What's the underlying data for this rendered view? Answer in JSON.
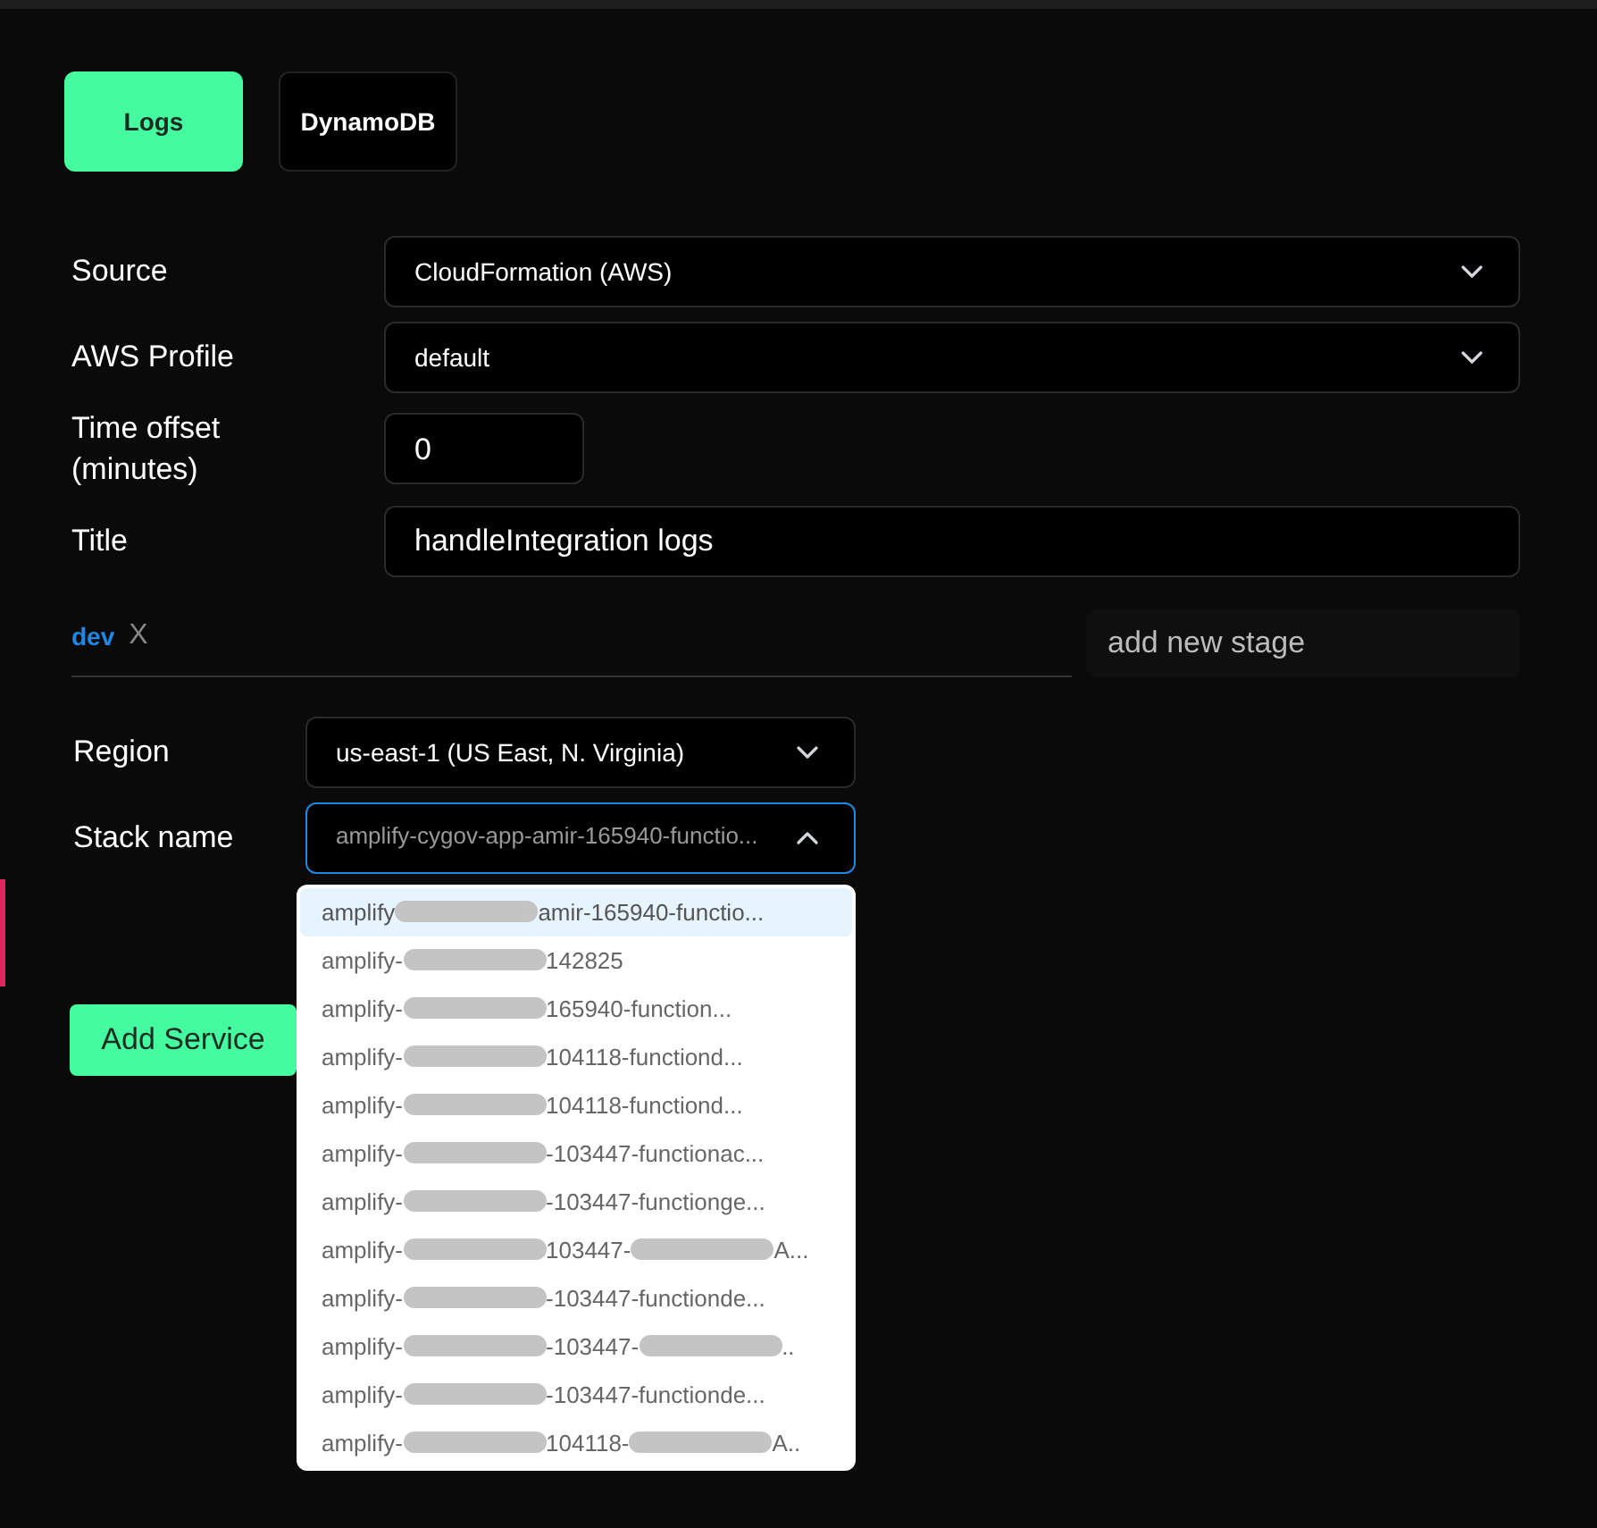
{
  "tabs": [
    {
      "label": "Logs",
      "selected": true
    },
    {
      "label": "DynamoDB",
      "selected": false
    }
  ],
  "form": {
    "source": {
      "label": "Source",
      "value": "CloudFormation (AWS)"
    },
    "aws_profile": {
      "label": "AWS Profile",
      "value": "default"
    },
    "time_offset": {
      "label": "Time offset (minutes)",
      "value": "0"
    },
    "title": {
      "label": "Title",
      "value": "handleIntegration logs"
    }
  },
  "stages": {
    "tags": [
      {
        "label": "dev",
        "remove": "X"
      }
    ],
    "new_stage": {
      "placeholder": "add new stage"
    }
  },
  "region": {
    "label": "Region",
    "value": "us-east-1 (US East, N. Virginia)"
  },
  "stack_name": {
    "label": "Stack name",
    "value": "amplify-cygov-app-amir-165940-functio...",
    "expanded": true,
    "options": [
      {
        "parts": [
          "amplify",
          "amir-165940-functio..."
        ],
        "selected": true
      },
      {
        "parts": [
          "amplify-",
          "142825"
        ],
        "selected": false
      },
      {
        "parts": [
          "amplify-",
          "165940-function..."
        ],
        "selected": false
      },
      {
        "parts": [
          "amplify-",
          "104118-functiond..."
        ],
        "selected": false
      },
      {
        "parts": [
          "amplify-",
          "104118-functiond..."
        ],
        "selected": false
      },
      {
        "parts": [
          "amplify-",
          "-103447-functionac..."
        ],
        "selected": false
      },
      {
        "parts": [
          "amplify-",
          "-103447-functionge..."
        ],
        "selected": false
      },
      {
        "parts": [
          "amplify-",
          "103447-",
          "A..."
        ],
        "selected": false
      },
      {
        "parts": [
          "amplify-",
          "-103447-functionde..."
        ],
        "selected": false
      },
      {
        "parts": [
          "amplify-",
          "-103447-",
          ".."
        ],
        "selected": false
      },
      {
        "parts": [
          "amplify-",
          "-103447-functionde..."
        ],
        "selected": false
      },
      {
        "parts": [
          "amplify-",
          "104118-",
          "A.."
        ],
        "selected": false
      }
    ]
  },
  "add_service_button": "Add Service"
}
